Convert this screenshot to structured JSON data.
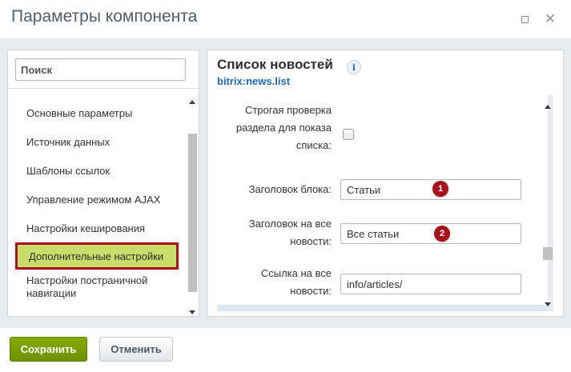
{
  "dialog": {
    "title": "Параметры компонента"
  },
  "sidebar": {
    "search_placeholder": "Поиск",
    "items": [
      {
        "label": "Основные параметры"
      },
      {
        "label": "Источник данных"
      },
      {
        "label": "Шаблоны ссылок"
      },
      {
        "label": "Управление режимом AJAX"
      },
      {
        "label": "Настройки кеширования"
      },
      {
        "label": "Дополнительные настройки",
        "active": true
      },
      {
        "label": "Настройки постраничной навигации"
      }
    ]
  },
  "component": {
    "name": "Список новостей",
    "code": "bitrix:news.list",
    "info_icon": "i"
  },
  "params": {
    "strict_check": {
      "label": "Строгая проверка раздела для показа списка:",
      "checked": false
    },
    "block_title": {
      "label": "Заголовок блока:",
      "value": "Статьи",
      "marker": "1"
    },
    "all_news_title": {
      "label": "Заголовок на все новости:",
      "value": "Все статьи",
      "marker": "2"
    },
    "all_news_link": {
      "label": "Ссылка на все новости:",
      "value": "info/articles/"
    }
  },
  "footer": {
    "save_label": "Сохранить",
    "cancel_label": "Отменить"
  },
  "colors": {
    "accent_active": "#c9dd6a",
    "highlight_border": "#a8121c",
    "save_button": "#7aa100",
    "link_blue": "#2067b0"
  }
}
